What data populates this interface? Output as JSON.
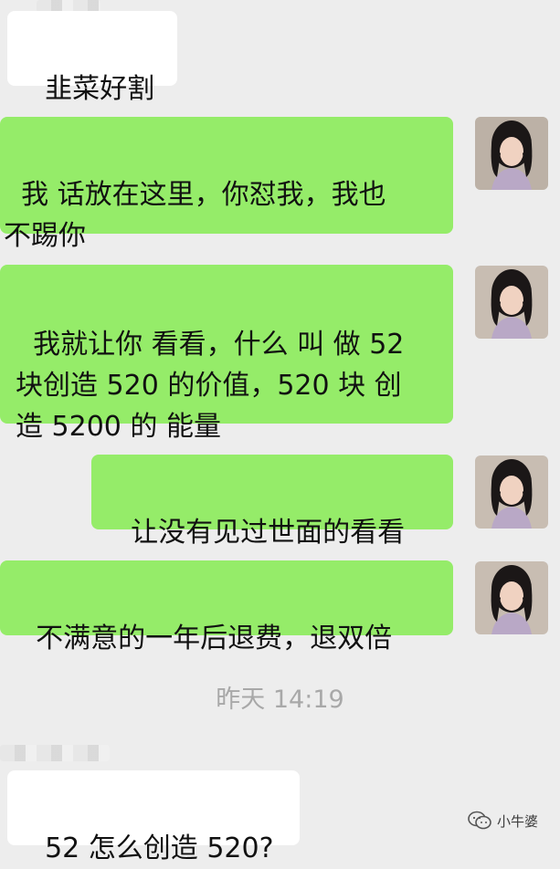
{
  "messages": [
    {
      "direction": "incoming",
      "text": "韭菜好割"
    },
    {
      "direction": "outgoing",
      "text": "我 话放在这里，你怼我，我也\n不踢你"
    },
    {
      "direction": "outgoing",
      "text": "我就让你 看看，什么 叫 做 52\n块创造 520 的价值，520 块 创\n造 5200 的 能量"
    },
    {
      "direction": "outgoing",
      "text": "让没有见过世面的看看"
    },
    {
      "direction": "outgoing",
      "text": "不满意的一年后退费，退双倍"
    }
  ],
  "timestamp": "昨天 14:19",
  "last_message": {
    "direction": "incoming",
    "text": "52 怎么创造 520?"
  },
  "watermark": {
    "text": "小牛婆",
    "icon": "wechat-channel-icon"
  },
  "colors": {
    "outgoing_bubble": "#95ec69",
    "incoming_bubble": "#ffffff",
    "background": "#ededed"
  }
}
